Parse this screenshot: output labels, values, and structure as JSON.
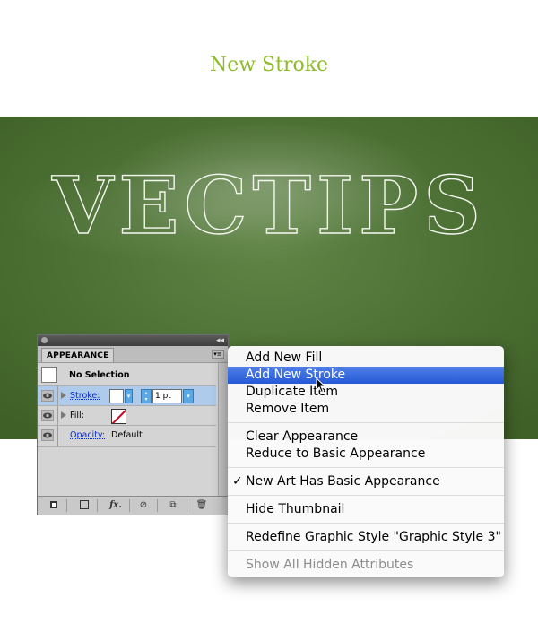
{
  "title": "New Stroke",
  "board_text": "VECTIPS",
  "colors": {
    "title": "#8dbb2c",
    "board": "#4c7034",
    "highlight": "#2559d6",
    "no_fill_slash": "#d0021b"
  },
  "panel": {
    "tab": "APPEARANCE",
    "no_selection": "No Selection",
    "stroke_label": "Stroke:",
    "stroke_weight": "1 pt",
    "fill_label": "Fill:",
    "opacity_label": "Opacity:",
    "opacity_value": "Default",
    "footer_icons": [
      "add-stroke-icon",
      "add-fill-icon",
      "fx-icon",
      "clear-icon",
      "duplicate-icon",
      "trash-icon"
    ],
    "fx_label": "fx."
  },
  "menu": {
    "add_new_fill": "Add New Fill",
    "add_new_stroke": "Add New Stroke",
    "duplicate_item": "Duplicate Item",
    "remove_item": "Remove Item",
    "clear_appearance": "Clear Appearance",
    "reduce_basic": "Reduce to Basic Appearance",
    "new_art_basic": "New Art Has Basic Appearance",
    "new_art_checked": true,
    "hide_thumbnail": "Hide Thumbnail",
    "redefine_style": "Redefine Graphic Style \"Graphic Style 3\"",
    "show_hidden": "Show All Hidden Attributes"
  }
}
